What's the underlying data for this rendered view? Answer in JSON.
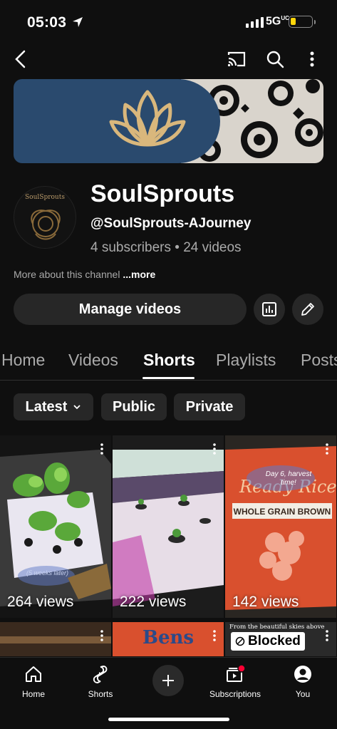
{
  "status_bar": {
    "time": "05:03",
    "network": "5G",
    "network_sup": "UC"
  },
  "channel": {
    "name": "SoulSprouts",
    "handle": "@SoulSprouts-AJourney",
    "stats": "4 subscribers • 24 videos",
    "avatar_caption": "SoulSprouts",
    "about": "More about this channel",
    "about_more": "...more"
  },
  "actions": {
    "manage_videos": "Manage videos"
  },
  "tabs": [
    {
      "label": "Home"
    },
    {
      "label": "Videos"
    },
    {
      "label": "Shorts"
    },
    {
      "label": "Playlists"
    },
    {
      "label": "Posts"
    }
  ],
  "active_tab": "Shorts",
  "chips": [
    {
      "label": "Latest"
    },
    {
      "label": "Public"
    },
    {
      "label": "Private"
    }
  ],
  "shorts": [
    {
      "views": "264 views",
      "overlay": "(5 weeks later)"
    },
    {
      "views": "222 views",
      "overlay": ""
    },
    {
      "views": "142 views",
      "overlay": "Day 6, harvest time!"
    }
  ],
  "shorts_row2": {
    "third_caption": "From the beautiful skies above",
    "third_badge": "Blocked"
  },
  "bottom_nav": [
    {
      "label": "Home"
    },
    {
      "label": "Shorts"
    },
    {
      "label": "Subscriptions"
    },
    {
      "label": "You"
    }
  ],
  "colors": {
    "background": "#0f0f0f",
    "banner_blue": "#2a4a6e",
    "gold": "#d9b77c",
    "battery": "#ffd60a",
    "badge_red": "#ff0033"
  }
}
